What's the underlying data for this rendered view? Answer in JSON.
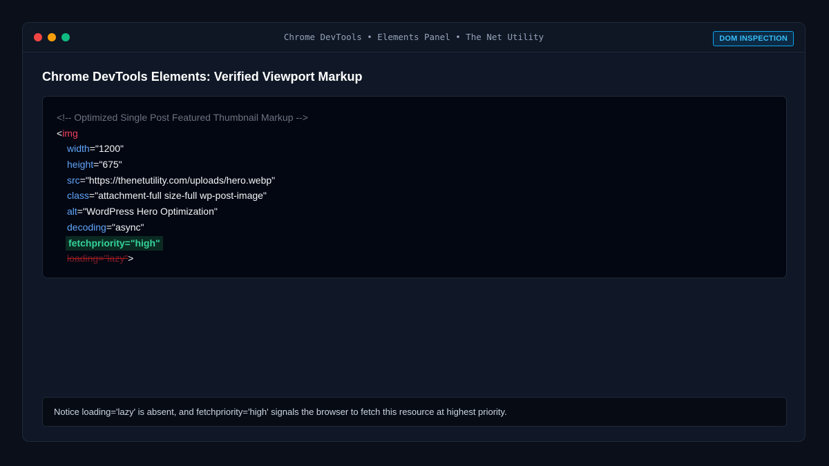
{
  "window": {
    "title": "Chrome DevTools • Elements Panel • The Net Utility",
    "badge": "DOM INSPECTION"
  },
  "main": {
    "heading": "Chrome DevTools Elements: Verified Viewport Markup"
  },
  "code": {
    "comment": "<!-- Optimized Single Post Featured Thumbnail Markup -->",
    "open_bracket": "<",
    "tag": "img",
    "attributes": [
      {
        "name": "width",
        "value": "\"1200\""
      },
      {
        "name": "height",
        "value": "\"675\""
      },
      {
        "name": "src",
        "value": "\"https://thenetutility.com/uploads/hero.webp\""
      },
      {
        "name": "class",
        "value": "\"attachment-full size-full wp-post-image\""
      },
      {
        "name": "alt",
        "value": "\"WordPress Hero Optimization\""
      },
      {
        "name": "decoding",
        "value": "\"async\""
      }
    ],
    "highlighted": "fetchpriority=\"high\"",
    "removed": "loading=\"lazy\"",
    "close_bracket": ">",
    "equals": "="
  },
  "note": {
    "text": "Notice loading='lazy' is absent, and fetchpriority='high' signals the browser to fetch this resource at highest priority."
  },
  "colors": {
    "background": "#0b0f19",
    "tag": "#f43f5e",
    "attribute": "#60a5fa",
    "highlight": "#34d399",
    "badge": "#38bdf8"
  }
}
